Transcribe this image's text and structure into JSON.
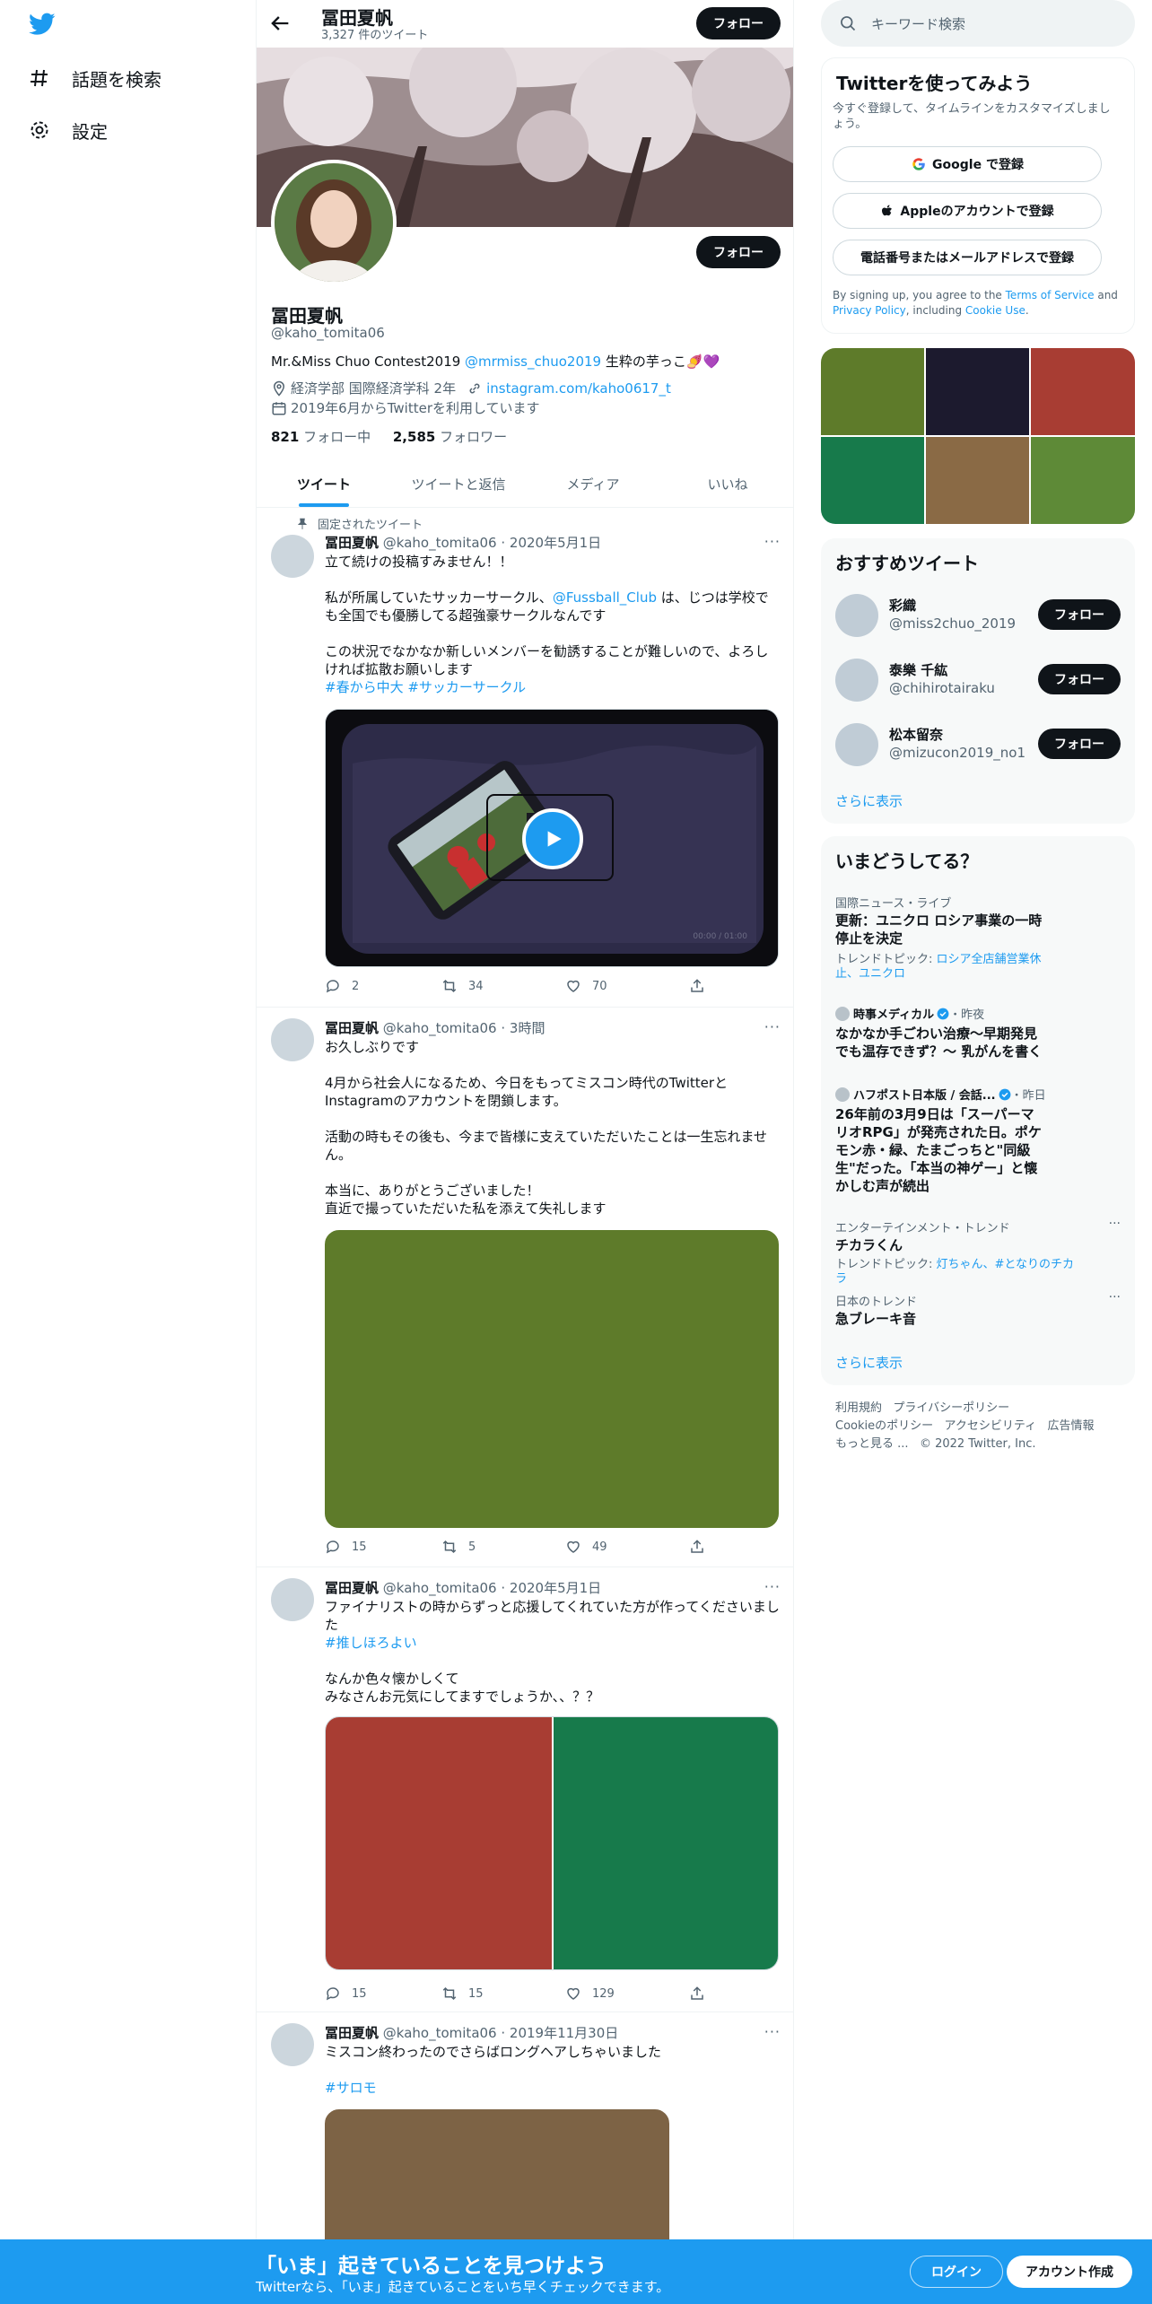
{
  "nav": {
    "explore": "話題を検索",
    "settings": "設定"
  },
  "header": {
    "name": "冨田夏帆",
    "tweet_count": "3,327 件のツイート",
    "follow": "フォロー"
  },
  "profile": {
    "name": "冨田夏帆",
    "handle": "@kaho_tomita06",
    "follow": "フォロー",
    "bio_prefix": "Mr.&Miss Chuo Contest2019 ",
    "bio_mention": "@mrmiss_chuo2019",
    "bio_suffix": " 生粋の芋っこ🍠💜",
    "location": "経済学部 国際経済学科 2年",
    "link": "instagram.com/kaho0617_t",
    "joined": "2019年6月からTwitterを利用しています",
    "following_count": "821",
    "following_label": " フォロー中",
    "followers_count": "2,585",
    "followers_label": " フォロワー"
  },
  "tabs": [
    "ツイート",
    "ツイートと返信",
    "メディア",
    "いいね"
  ],
  "tweets": [
    {
      "pinned_label": "固定されたツイート",
      "name": "冨田夏帆",
      "meta": "@kaho_tomita06 · 2020年5月1日",
      "line1": "立て続けの投稿すみません！！",
      "line2a": "私が所属していたサッカーサークル、",
      "mention": "@Fussball_Club",
      "line2b": "は、じつは学校でも全国でも優勝してる超強豪サークルなんです",
      "line3": "この状況でなかなか新しいメンバーを勧誘することが難しいので、よろしければ拡散お願いします",
      "hashtags": "#春から中大 #サッカーサークル",
      "video_time": "00:00 / 01:00",
      "replies": "2",
      "retweets": "34",
      "likes": "70"
    },
    {
      "name": "冨田夏帆",
      "meta": "@kaho_tomita06 · 3時間",
      "line1": "お久しぶりです",
      "line2": "4月から社会人になるため、今日をもってミスコン時代のTwitterとInstagramのアカウントを閉鎖します。",
      "line3": "活動の時もその後も、今まで皆様に支えていただいたことは一生忘れません。",
      "line4": "本当に、ありがとうございました！",
      "line5": "直近で撮っていただいた私を添えて失礼します",
      "replies": "15",
      "retweets": "5",
      "likes": "49"
    },
    {
      "name": "冨田夏帆",
      "meta": "@kaho_tomita06 · 2020年5月1日",
      "line1": "ファイナリストの時からずっと応援してくれていた方が作ってくださいました",
      "hashtag": "#推しほろよい",
      "line2": "なんか色々懐かしくて",
      "line3": "みなさんお元気にしてますでしょうか、、？？",
      "replies": "15",
      "retweets": "15",
      "likes": "129"
    },
    {
      "name": "冨田夏帆",
      "meta": "@kaho_tomita06 · 2019年11月30日",
      "line1": "ミスコン終わったのでさらばロングヘアしちゃいました",
      "hashtag": "#サロモ"
    }
  ],
  "search": {
    "placeholder": "キーワード検索"
  },
  "signup": {
    "title": "Twitterを使ってみよう",
    "desc": "今すぐ登録して、タイムラインをカスタマイズしましょう。",
    "google": "Google で登録",
    "apple": "Appleのアカウントで登録",
    "phone": "電話番号またはメールアドレスで登録",
    "legal_1": "By signing up, you agree to the ",
    "terms": "Terms of Service",
    "legal_2": " and ",
    "privacy": "Privacy Policy",
    "legal_3": ", including ",
    "cookie": "Cookie Use",
    "legal_4": "."
  },
  "media_grid_colors": [
    "#5e7b2a",
    "#1c1a2e",
    "#a83d33",
    "#177a4b",
    "#8a6a45",
    "#5e8a37"
  ],
  "recommend": {
    "title": "おすすめツイート",
    "follow": "フォロー",
    "users": [
      {
        "name": "彩織",
        "handle": "@miss2chuo_2019"
      },
      {
        "name": "泰樂 千紘",
        "handle": "@chihirotairaku"
      },
      {
        "name": "松本留奈",
        "handle": "@mizucon2019_no1"
      }
    ],
    "more": "さらに表示"
  },
  "trends": {
    "title": "いまどうしてる？",
    "t1_cat": "国際ニュース・ライブ",
    "t1_title": "更新：ユニクロ ロシア事業の一時停止を決定",
    "t1_topic_label": "トレンドトピック: ",
    "t1_topic": "ロシア全店舗営業休止、ユニクロ",
    "t2_src": "時事メディカル",
    "t2_time": "・昨夜",
    "t2_title": "なかなか手ごわい治療～早期発見でも温存できず？～ 乳がんを書く",
    "t3_src": "ハフポスト日本版 / 会話...",
    "t3_time": "・昨日",
    "t3_title": "26年前の3月9日は「スーパーマリオRPG」が発売された日。ポケモン赤・緑、たまごっちと\"同級生\"だった。「本当の神ゲー」と懐かしむ声が続出",
    "t4_cat": "エンターテインメント・トレンド",
    "t4_title": "チカラくん",
    "t4_topic_label": "トレンドトピック: ",
    "t4_topic": "灯ちゃん、#となりのチカラ",
    "t5_cat": "日本のトレンド",
    "t5_title": "急ブレーキ音",
    "more": "さらに表示"
  },
  "footer": {
    "terms": "利用規約",
    "privacy": "プライバシーポリシー",
    "cookie": "Cookieのポリシー",
    "accessibility": "アクセシビリティ",
    "ads": "広告情報",
    "more": "もっと見る ...",
    "copyright": "© 2022 Twitter, Inc."
  },
  "bottom": {
    "title": "「いま」起きていることを見つけよう",
    "sub": "Twitterなら、「いま」起きていることをいち早くチェックできます。",
    "login": "ログイン",
    "signup": "アカウント作成"
  },
  "colors": {
    "accent": "#1d9bf0",
    "bottom_bar": "#1d9bf0",
    "media1": "#5e7b2a",
    "media2a": "#a83d33",
    "media2b": "#177a4b",
    "media3": "#7d6345"
  }
}
